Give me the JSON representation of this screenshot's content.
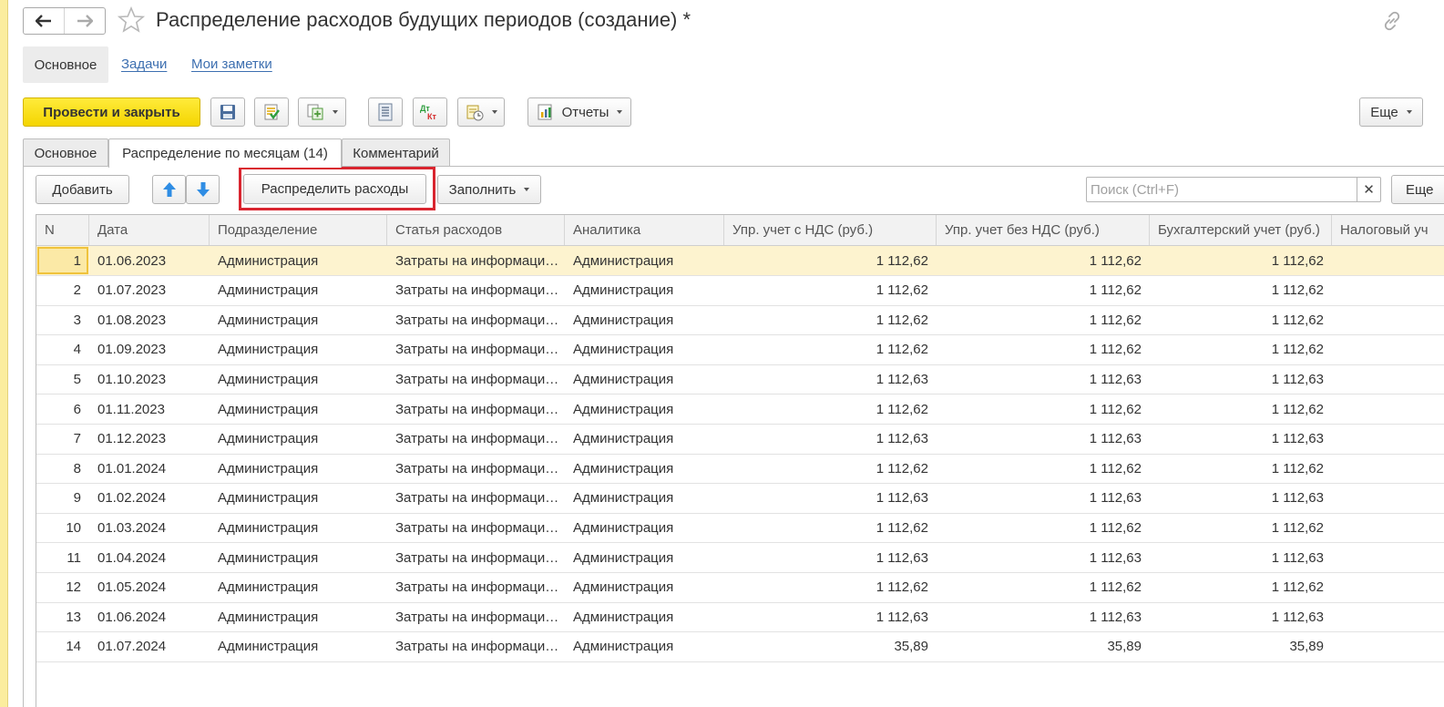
{
  "window": {
    "title": "Распределение расходов будущих периодов (создание) *"
  },
  "section_nav": {
    "items": [
      {
        "label": "Основное",
        "active": true
      },
      {
        "label": "Задачи",
        "active": false
      },
      {
        "label": "Мои заметки",
        "active": false
      }
    ]
  },
  "toolbar": {
    "post_close_label": "Провести и закрыть",
    "reports_label": "Отчеты",
    "more_label": "Еще"
  },
  "tabs": [
    {
      "label": "Основное",
      "active": false
    },
    {
      "label": "Распределение по месяцам (14)",
      "active": true
    },
    {
      "label": "Комментарий",
      "active": false
    }
  ],
  "table_toolbar": {
    "add_label": "Добавить",
    "distribute_label": "Распределить расходы",
    "fill_label": "Заполнить",
    "search_placeholder": "Поиск (Ctrl+F)",
    "more_label": "Еще"
  },
  "table": {
    "columns": [
      "N",
      "Дата",
      "Подразделение",
      "Статья расходов",
      "Аналитика",
      "Упр. учет с НДС (руб.)",
      "Упр. учет без НДС (руб.)",
      "Бухгалтерский учет (руб.)",
      "Налоговый уч"
    ],
    "rows": [
      [
        "1",
        "01.06.2023",
        "Администрация",
        "Затраты на информационные услуги",
        "Администрация",
        "1 112,62",
        "1 112,62",
        "1 112,62"
      ],
      [
        "2",
        "01.07.2023",
        "Администрация",
        "Затраты на информационные услуги",
        "Администрация",
        "1 112,62",
        "1 112,62",
        "1 112,62"
      ],
      [
        "3",
        "01.08.2023",
        "Администрация",
        "Затраты на информационные услуги",
        "Администрация",
        "1 112,62",
        "1 112,62",
        "1 112,62"
      ],
      [
        "4",
        "01.09.2023",
        "Администрация",
        "Затраты на информационные услуги",
        "Администрация",
        "1 112,62",
        "1 112,62",
        "1 112,62"
      ],
      [
        "5",
        "01.10.2023",
        "Администрация",
        "Затраты на информационные услуги",
        "Администрация",
        "1 112,63",
        "1 112,63",
        "1 112,63"
      ],
      [
        "6",
        "01.11.2023",
        "Администрация",
        "Затраты на информационные услуги",
        "Администрация",
        "1 112,62",
        "1 112,62",
        "1 112,62"
      ],
      [
        "7",
        "01.12.2023",
        "Администрация",
        "Затраты на информационные услуги",
        "Администрация",
        "1 112,63",
        "1 112,63",
        "1 112,63"
      ],
      [
        "8",
        "01.01.2024",
        "Администрация",
        "Затраты на информационные услуги",
        "Администрация",
        "1 112,62",
        "1 112,62",
        "1 112,62"
      ],
      [
        "9",
        "01.02.2024",
        "Администрация",
        "Затраты на информационные услуги",
        "Администрация",
        "1 112,63",
        "1 112,63",
        "1 112,63"
      ],
      [
        "10",
        "01.03.2024",
        "Администрация",
        "Затраты на информационные услуги",
        "Администрация",
        "1 112,62",
        "1 112,62",
        "1 112,62"
      ],
      [
        "11",
        "01.04.2024",
        "Администрация",
        "Затраты на информационные услуги",
        "Администрация",
        "1 112,63",
        "1 112,63",
        "1 112,63"
      ],
      [
        "12",
        "01.05.2024",
        "Администрация",
        "Затраты на информационные услуги",
        "Администрация",
        "1 112,62",
        "1 112,62",
        "1 112,62"
      ],
      [
        "13",
        "01.06.2024",
        "Администрация",
        "Затраты на информационные услуги",
        "Администрация",
        "1 112,63",
        "1 112,63",
        "1 112,63"
      ],
      [
        "14",
        "01.07.2024",
        "Администрация",
        "Затраты на информационные услуги",
        "Администрация",
        "35,89",
        "35,89",
        "35,89"
      ]
    ],
    "selected_row": 0
  },
  "colors": {
    "accent_yellow": "#f4d500",
    "highlight_red": "#d9252f",
    "link_blue": "#3d6fb0",
    "selected_row": "#fdf3cf"
  }
}
